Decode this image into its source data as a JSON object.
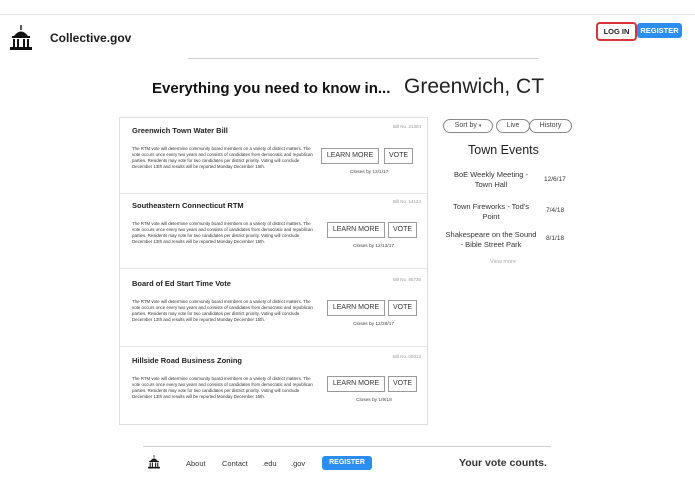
{
  "header": {
    "site_name": "Collective.gov",
    "login_label": "LOG IN",
    "register_label": "REGISTER"
  },
  "hero": {
    "headline": "Everything you need to know in...",
    "city": "Greenwich, CT"
  },
  "bills": [
    {
      "title": "Greenwich Town Water Bill",
      "bill_no": "Bill No. 21304",
      "description": "The RTM vote will determine community board members on a variety of district matters. The vote occurs once every two years and consists of candidates from democratic and republican parties. Residents may vote for two candidates per district priority. Voting will conclude December 13th and results will be reported Monday December 15th.",
      "learn_more": "LEARN MORE",
      "vote": "VOTE",
      "closes": "Closes by 12/1/17"
    },
    {
      "title": "Southeastern Connecticut RTM",
      "bill_no": "Bill No. 14124",
      "description": "The RTM vote will determine community board members on a variety of district matters. The vote occurs once every two years and consists of candidates from democratic and republican parties. Residents may vote for two candidates per district priority. Voting will conclude December 13th and results will be reported Monday December 15th.",
      "learn_more": "LEARN MORE",
      "vote": "VOTE",
      "closes": "Closes by 12/13/17"
    },
    {
      "title": "Board of Ed Start Time Vote",
      "bill_no": "Bill No. 85730",
      "description": "The RTM vote will determine community board members on a variety of district matters. The vote occurs once every two years and consists of candidates from democratic and republican parties. Residents may vote for two candidates per district priority. Voting will conclude December 13th and results will be reported Monday December 15th.",
      "learn_more": "LEARN MORE",
      "vote": "VOTE",
      "closes": "Closes by 12/26/17"
    },
    {
      "title": "Hillside Road Business Zoning",
      "bill_no": "Bill No. 09313",
      "description": "The RTM vote will determine community board members on a variety of district matters. The vote occurs once every two years and consists of candidates from democratic and republican parties. Residents may vote for two candidates per district priority. Voting will conclude December 13th and results will be reported Monday December 15th.",
      "learn_more": "LEARN MORE",
      "vote": "VOTE",
      "closes": "Closes by 1/9/18"
    }
  ],
  "filters": {
    "sort_by": "Sort by",
    "live": "Live",
    "history": "History"
  },
  "events": {
    "title": "Town Events",
    "items": [
      {
        "name": "BoE Weekly Meeting - Town Hall",
        "date": "12/6/17"
      },
      {
        "name": "Town Fireworks - Tod's Point",
        "date": "7/4/18"
      },
      {
        "name": "Shakespeare on the Sound - Bible Street Park",
        "date": "8/1/18"
      }
    ],
    "view_more": "View more"
  },
  "footer": {
    "links": [
      "About",
      "Contact",
      ".edu",
      ".gov"
    ],
    "register_label": "REGISTER",
    "tagline": "Your vote counts."
  },
  "colors": {
    "accent": "#2c8df0",
    "login_outline": "#d9323a"
  },
  "icons": [
    "capitol-building-icon",
    "chevron-down-icon"
  ]
}
